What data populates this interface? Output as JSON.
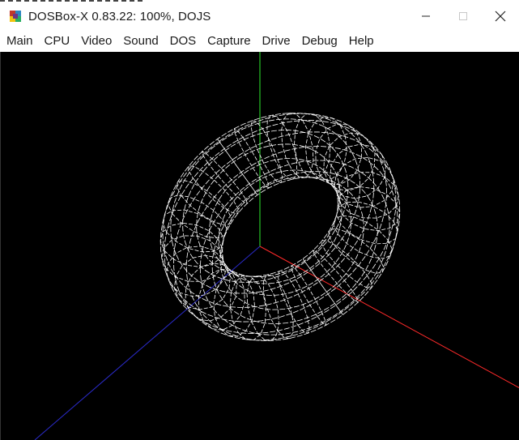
{
  "window": {
    "title": "DOSBox-X 0.83.22: 100%, DOJS",
    "app_icon": "dosbox-x-icon",
    "controls": [
      {
        "name": "minimize-button",
        "icon": "minimize-icon"
      },
      {
        "name": "maximize-button",
        "icon": "maximize-icon"
      },
      {
        "name": "close-button",
        "icon": "close-icon"
      }
    ]
  },
  "menubar": {
    "items": [
      "Main",
      "CPU",
      "Video",
      "Sound",
      "DOS",
      "Capture",
      "Drive",
      "Debug",
      "Help"
    ]
  },
  "scene": {
    "background": "#000000",
    "axis_colors": {
      "x": "#ff2a2a",
      "y": "#2eea2e",
      "z": "#2b2bcc"
    },
    "object": "wireframe torus",
    "wire_color": "#ffffff"
  }
}
